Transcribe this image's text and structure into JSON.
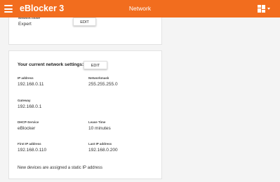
{
  "header": {
    "app_title": "eBlocker 3",
    "page_title": "Network",
    "menu_icon": "hamburger-menu-icon",
    "apps_icon": "grid-apps-icon",
    "dropdown_icon": "chevron-down-icon",
    "accent_color": "#f26d1e"
  },
  "mode_card": {
    "label": "Network mode",
    "value": "Expert",
    "edit_label": "EDIT"
  },
  "settings_card": {
    "title": "Your current network settings:",
    "edit_label": "EDIT",
    "ip_address": {
      "label": "IP address",
      "value": "192.168.0.11"
    },
    "netmask": {
      "label": "Networkmask",
      "value": "255.255.255.0"
    },
    "gateway": {
      "label": "Gateway",
      "value": "192.168.0.1"
    },
    "dhcp_service": {
      "label": "DHCP-Service",
      "value": "eBlocker"
    },
    "lease_time": {
      "label": "Lease Time",
      "value": "10 minutes"
    },
    "first_ip": {
      "label": "First IP address",
      "value": "192.168.0.110"
    },
    "last_ip": {
      "label": "Last IP address",
      "value": "192.168.0.200"
    },
    "note": "New devices are assigned a static IP address"
  }
}
